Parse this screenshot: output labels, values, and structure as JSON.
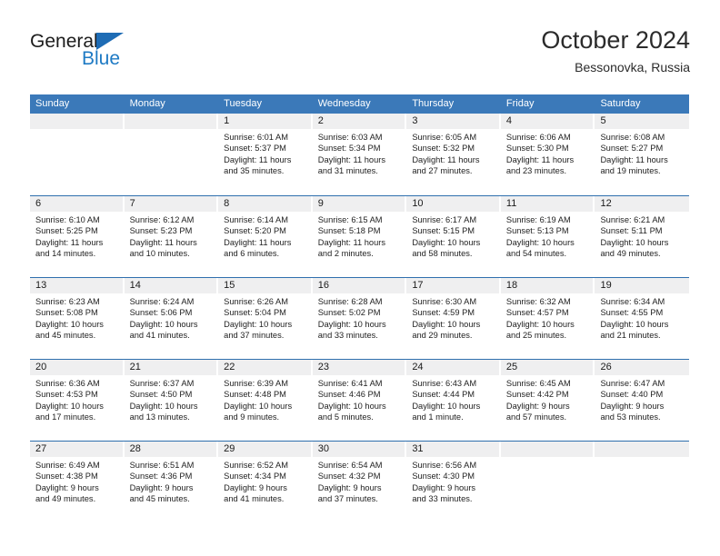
{
  "brand": {
    "name_part1": "General",
    "name_part2": "Blue"
  },
  "header": {
    "title": "October 2024",
    "location": "Bessonovka, Russia"
  },
  "colors": {
    "header_blue": "#3b79b9",
    "row_rule_blue": "#2f6fae",
    "daynum_band": "#efeff0",
    "brand_blue": "#1e7ac4"
  },
  "weekdays": [
    "Sunday",
    "Monday",
    "Tuesday",
    "Wednesday",
    "Thursday",
    "Friday",
    "Saturday"
  ],
  "weeks": [
    [
      {
        "day": "",
        "sunrise": "",
        "sunset": "",
        "daylight1": "",
        "daylight2": ""
      },
      {
        "day": "",
        "sunrise": "",
        "sunset": "",
        "daylight1": "",
        "daylight2": ""
      },
      {
        "day": "1",
        "sunrise": "Sunrise: 6:01 AM",
        "sunset": "Sunset: 5:37 PM",
        "daylight1": "Daylight: 11 hours",
        "daylight2": "and 35 minutes."
      },
      {
        "day": "2",
        "sunrise": "Sunrise: 6:03 AM",
        "sunset": "Sunset: 5:34 PM",
        "daylight1": "Daylight: 11 hours",
        "daylight2": "and 31 minutes."
      },
      {
        "day": "3",
        "sunrise": "Sunrise: 6:05 AM",
        "sunset": "Sunset: 5:32 PM",
        "daylight1": "Daylight: 11 hours",
        "daylight2": "and 27 minutes."
      },
      {
        "day": "4",
        "sunrise": "Sunrise: 6:06 AM",
        "sunset": "Sunset: 5:30 PM",
        "daylight1": "Daylight: 11 hours",
        "daylight2": "and 23 minutes."
      },
      {
        "day": "5",
        "sunrise": "Sunrise: 6:08 AM",
        "sunset": "Sunset: 5:27 PM",
        "daylight1": "Daylight: 11 hours",
        "daylight2": "and 19 minutes."
      }
    ],
    [
      {
        "day": "6",
        "sunrise": "Sunrise: 6:10 AM",
        "sunset": "Sunset: 5:25 PM",
        "daylight1": "Daylight: 11 hours",
        "daylight2": "and 14 minutes."
      },
      {
        "day": "7",
        "sunrise": "Sunrise: 6:12 AM",
        "sunset": "Sunset: 5:23 PM",
        "daylight1": "Daylight: 11 hours",
        "daylight2": "and 10 minutes."
      },
      {
        "day": "8",
        "sunrise": "Sunrise: 6:14 AM",
        "sunset": "Sunset: 5:20 PM",
        "daylight1": "Daylight: 11 hours",
        "daylight2": "and 6 minutes."
      },
      {
        "day": "9",
        "sunrise": "Sunrise: 6:15 AM",
        "sunset": "Sunset: 5:18 PM",
        "daylight1": "Daylight: 11 hours",
        "daylight2": "and 2 minutes."
      },
      {
        "day": "10",
        "sunrise": "Sunrise: 6:17 AM",
        "sunset": "Sunset: 5:15 PM",
        "daylight1": "Daylight: 10 hours",
        "daylight2": "and 58 minutes."
      },
      {
        "day": "11",
        "sunrise": "Sunrise: 6:19 AM",
        "sunset": "Sunset: 5:13 PM",
        "daylight1": "Daylight: 10 hours",
        "daylight2": "and 54 minutes."
      },
      {
        "day": "12",
        "sunrise": "Sunrise: 6:21 AM",
        "sunset": "Sunset: 5:11 PM",
        "daylight1": "Daylight: 10 hours",
        "daylight2": "and 49 minutes."
      }
    ],
    [
      {
        "day": "13",
        "sunrise": "Sunrise: 6:23 AM",
        "sunset": "Sunset: 5:08 PM",
        "daylight1": "Daylight: 10 hours",
        "daylight2": "and 45 minutes."
      },
      {
        "day": "14",
        "sunrise": "Sunrise: 6:24 AM",
        "sunset": "Sunset: 5:06 PM",
        "daylight1": "Daylight: 10 hours",
        "daylight2": "and 41 minutes."
      },
      {
        "day": "15",
        "sunrise": "Sunrise: 6:26 AM",
        "sunset": "Sunset: 5:04 PM",
        "daylight1": "Daylight: 10 hours",
        "daylight2": "and 37 minutes."
      },
      {
        "day": "16",
        "sunrise": "Sunrise: 6:28 AM",
        "sunset": "Sunset: 5:02 PM",
        "daylight1": "Daylight: 10 hours",
        "daylight2": "and 33 minutes."
      },
      {
        "day": "17",
        "sunrise": "Sunrise: 6:30 AM",
        "sunset": "Sunset: 4:59 PM",
        "daylight1": "Daylight: 10 hours",
        "daylight2": "and 29 minutes."
      },
      {
        "day": "18",
        "sunrise": "Sunrise: 6:32 AM",
        "sunset": "Sunset: 4:57 PM",
        "daylight1": "Daylight: 10 hours",
        "daylight2": "and 25 minutes."
      },
      {
        "day": "19",
        "sunrise": "Sunrise: 6:34 AM",
        "sunset": "Sunset: 4:55 PM",
        "daylight1": "Daylight: 10 hours",
        "daylight2": "and 21 minutes."
      }
    ],
    [
      {
        "day": "20",
        "sunrise": "Sunrise: 6:36 AM",
        "sunset": "Sunset: 4:53 PM",
        "daylight1": "Daylight: 10 hours",
        "daylight2": "and 17 minutes."
      },
      {
        "day": "21",
        "sunrise": "Sunrise: 6:37 AM",
        "sunset": "Sunset: 4:50 PM",
        "daylight1": "Daylight: 10 hours",
        "daylight2": "and 13 minutes."
      },
      {
        "day": "22",
        "sunrise": "Sunrise: 6:39 AM",
        "sunset": "Sunset: 4:48 PM",
        "daylight1": "Daylight: 10 hours",
        "daylight2": "and 9 minutes."
      },
      {
        "day": "23",
        "sunrise": "Sunrise: 6:41 AM",
        "sunset": "Sunset: 4:46 PM",
        "daylight1": "Daylight: 10 hours",
        "daylight2": "and 5 minutes."
      },
      {
        "day": "24",
        "sunrise": "Sunrise: 6:43 AM",
        "sunset": "Sunset: 4:44 PM",
        "daylight1": "Daylight: 10 hours",
        "daylight2": "and 1 minute."
      },
      {
        "day": "25",
        "sunrise": "Sunrise: 6:45 AM",
        "sunset": "Sunset: 4:42 PM",
        "daylight1": "Daylight: 9 hours",
        "daylight2": "and 57 minutes."
      },
      {
        "day": "26",
        "sunrise": "Sunrise: 6:47 AM",
        "sunset": "Sunset: 4:40 PM",
        "daylight1": "Daylight: 9 hours",
        "daylight2": "and 53 minutes."
      }
    ],
    [
      {
        "day": "27",
        "sunrise": "Sunrise: 6:49 AM",
        "sunset": "Sunset: 4:38 PM",
        "daylight1": "Daylight: 9 hours",
        "daylight2": "and 49 minutes."
      },
      {
        "day": "28",
        "sunrise": "Sunrise: 6:51 AM",
        "sunset": "Sunset: 4:36 PM",
        "daylight1": "Daylight: 9 hours",
        "daylight2": "and 45 minutes."
      },
      {
        "day": "29",
        "sunrise": "Sunrise: 6:52 AM",
        "sunset": "Sunset: 4:34 PM",
        "daylight1": "Daylight: 9 hours",
        "daylight2": "and 41 minutes."
      },
      {
        "day": "30",
        "sunrise": "Sunrise: 6:54 AM",
        "sunset": "Sunset: 4:32 PM",
        "daylight1": "Daylight: 9 hours",
        "daylight2": "and 37 minutes."
      },
      {
        "day": "31",
        "sunrise": "Sunrise: 6:56 AM",
        "sunset": "Sunset: 4:30 PM",
        "daylight1": "Daylight: 9 hours",
        "daylight2": "and 33 minutes."
      },
      {
        "day": "",
        "sunrise": "",
        "sunset": "",
        "daylight1": "",
        "daylight2": ""
      },
      {
        "day": "",
        "sunrise": "",
        "sunset": "",
        "daylight1": "",
        "daylight2": ""
      }
    ]
  ]
}
